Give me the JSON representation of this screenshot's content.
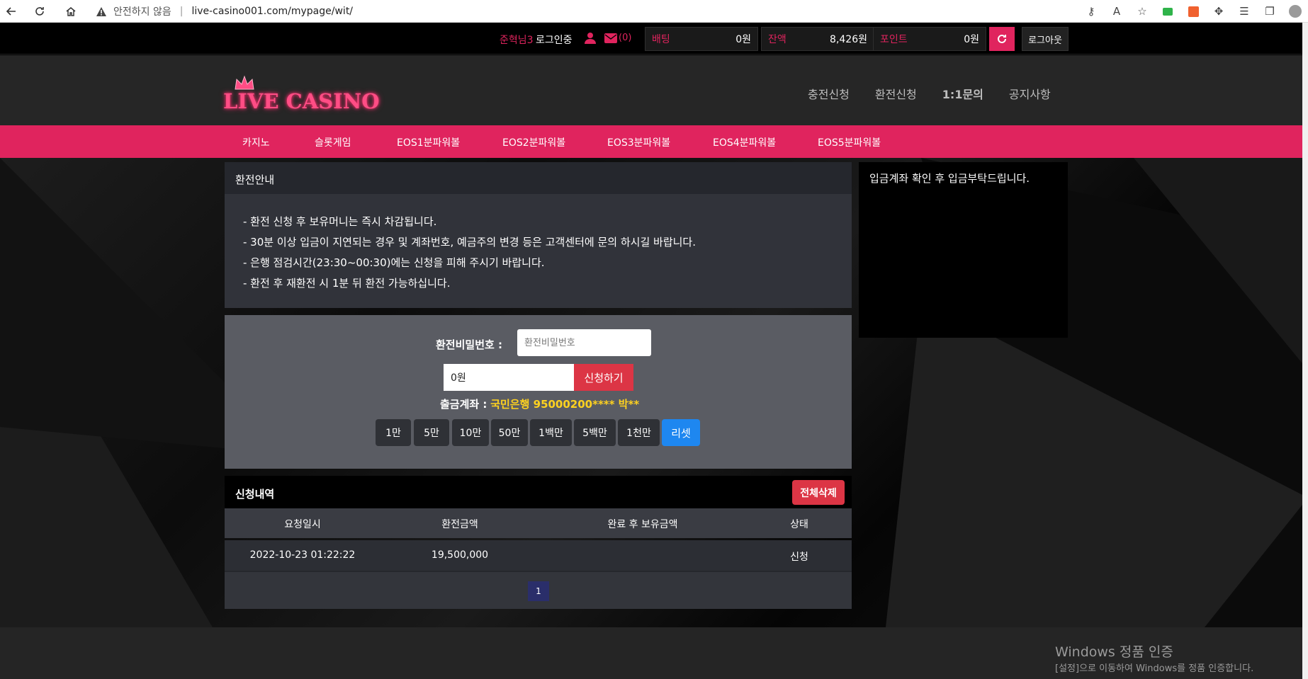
{
  "browser": {
    "security_warning": "안전하지 않음",
    "url": "live-casino001.com/mypage/wit/"
  },
  "userbar": {
    "username": "준혁님3",
    "status": "로그인중",
    "mail_count": "(0)",
    "stats": [
      {
        "label": "배팅",
        "value": "0원"
      },
      {
        "label": "잔액",
        "value": "8,426원"
      },
      {
        "label": "포인트",
        "value": "0원"
      }
    ],
    "logout": "로그아웃"
  },
  "header": {
    "logo_text": "LIVE CASINO",
    "nav": [
      "충전신청",
      "환전신청",
      "1:1문의",
      "공지사항"
    ]
  },
  "menu": [
    "카지노",
    "슬롯게임",
    "EOS1분파워볼",
    "EOS2분파워볼",
    "EOS3분파워볼",
    "EOS4분파워볼",
    "EOS5분파워볼"
  ],
  "info": {
    "title": "환전안내",
    "lines": [
      "- 환전 신청 후 보유머니는 즉시 차감됩니다.",
      "- 30분 이상 입금이 지연되는 경우 및 계좌번호, 예금주의 변경 등은 고객센터에 문의 하시길 바랍니다.",
      "- 은행 점검시간(23:30~00:30)에는 신청을 피해 주시기 바랍니다.",
      "- 환전 후 재환전 시 1분 뒤 환전 가능하십니다."
    ]
  },
  "form": {
    "password_label": "환전비밀번호 :",
    "password_placeholder": "환전비밀번호",
    "amount_value": "0원",
    "apply": "신청하기",
    "account_label": "출금계좌 :",
    "account_value": "국민은행 95000200**** 박**",
    "amounts": [
      "1만",
      "5만",
      "10만",
      "50만",
      "1백만",
      "5백만",
      "1천만"
    ],
    "reset": "리셋"
  },
  "history": {
    "title": "신청내역",
    "delete_all": "전체삭제",
    "columns": [
      "요청일시",
      "환전금액",
      "완료 후 보유금액",
      "상태"
    ],
    "rows": [
      {
        "date": "2022-10-23 01:22:22",
        "amount": "19,500,000",
        "after": "",
        "status": "신청"
      }
    ],
    "page": "1"
  },
  "side_notice": "입금계좌 확인 후 입금부탁드립니다.",
  "windows": {
    "title": "Windows 정품 인증",
    "sub": "[설정]으로 이동하여 Windows를 정품 인증합니다."
  }
}
